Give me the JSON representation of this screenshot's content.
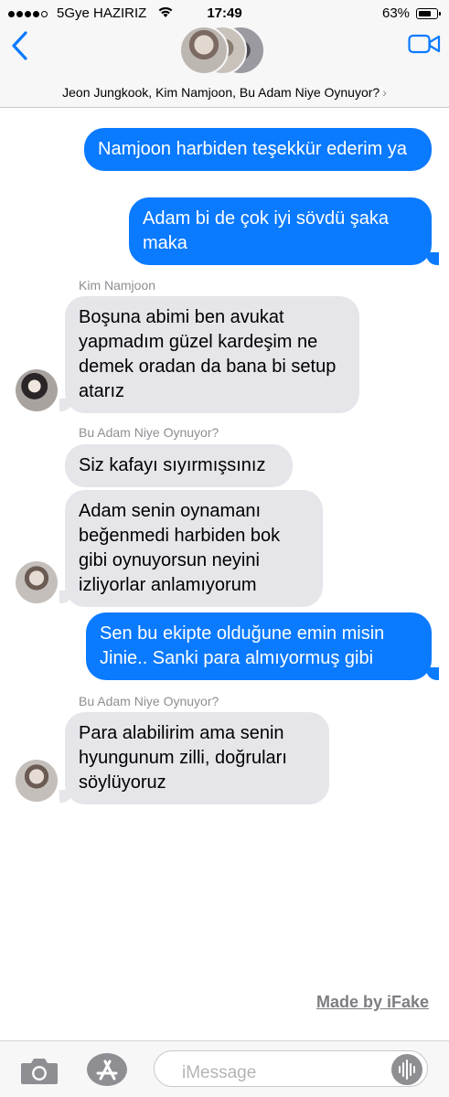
{
  "status_bar": {
    "carrier": "5Gye HAZIRIZ",
    "time": "17:49",
    "battery_percent": "63%",
    "signal_bars_filled": 4,
    "signal_bars_total": 5,
    "battery_level": 0.63
  },
  "header": {
    "participants": "Jeon Jungkook, Kim Namjoon, Bu Adam Niye Oynuyor?",
    "chevron": "›",
    "back_icon": "chevron-left-icon",
    "video_icon": "video-camera-icon"
  },
  "messages": [
    {
      "direction": "out",
      "text": "Namjoon harbiden teşekkür ederim ya"
    },
    {
      "direction": "out",
      "text": "Adam bi de çok iyi sövdü şaka maka"
    },
    {
      "direction": "in",
      "sender": "Kim Namjoon",
      "text": "Boşuna abimi ben avukat yapmadım güzel kardeşim ne demek oradan da bana bi setup atarız"
    },
    {
      "direction": "in",
      "sender": "Bu Adam Niye Oynuyor?",
      "text": "Siz kafayı sıyırmışsınız"
    },
    {
      "direction": "in",
      "text": "Adam senin oynamanı beğenmedi harbiden bok gibi oynuyorsun neyini izliyorlar anlamıyorum"
    },
    {
      "direction": "out",
      "text": "Sen bu ekipte olduğune emin misin Jinie.. Sanki para almıyormuş gibi"
    },
    {
      "direction": "in",
      "sender": "Bu Adam Niye Oynuyor?",
      "text": "Para alabilirim ama senin hyungunum zilli, doğruları söylüyoruz"
    }
  ],
  "watermark": "Made by iFake",
  "input_bar": {
    "placeholder": "iMessage",
    "camera_icon": "camera-icon",
    "apps_icon": "app-store-icon",
    "audio_icon": "audio-waveform-icon"
  },
  "colors": {
    "outgoing_bubble": "#0a7aff",
    "incoming_bubble": "#e5e5ea",
    "accent": "#0a7aff"
  }
}
